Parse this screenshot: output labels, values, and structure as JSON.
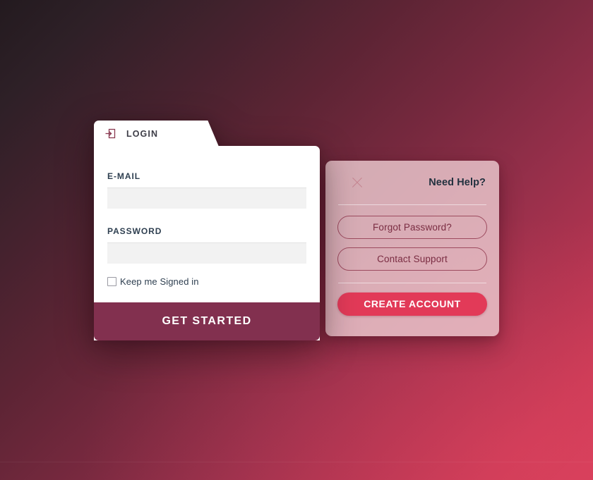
{
  "background": {
    "gradient_from": "#231a1f",
    "gradient_to": "#d43e59"
  },
  "login_card": {
    "tab": {
      "icon": "login-arrow-icon",
      "label": "LOGIN"
    },
    "email": {
      "label": "E-MAIL",
      "value": "",
      "placeholder": ""
    },
    "password": {
      "label": "PASSWORD",
      "value": "",
      "placeholder": ""
    },
    "remember": {
      "label": "Keep me Signed in",
      "checked": false
    },
    "submit_label": "GET STARTED",
    "submit_color": "#82304f"
  },
  "help_panel": {
    "close_icon": "close-x-icon",
    "title": "Need Help?",
    "buttons": [
      {
        "label": "Forgot Password?",
        "style": "outline"
      },
      {
        "label": "Contact Support",
        "style": "outline"
      },
      {
        "label": "CREATE ACCOUNT",
        "style": "solid",
        "color": "#e23a58"
      }
    ]
  }
}
